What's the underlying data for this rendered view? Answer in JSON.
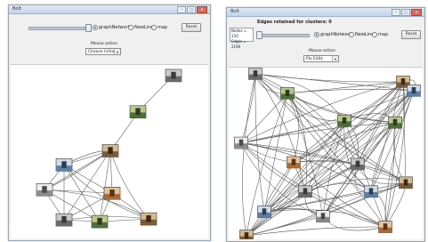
{
  "left_window": {
    "title": "Bolt",
    "radio_options": [
      "graphNetwork",
      "NewLine",
      "map"
    ],
    "selected_radio": "graphNetwork",
    "reset_label": "Reset",
    "mouse_action_label": "Mouse action",
    "mouse_action_value": "Choose Initiator"
  },
  "right_window": {
    "title": "Bolt",
    "heading": "Edges retained for clusters: 0",
    "info_lines": [
      "Nodes = 150",
      "Edges = 2190"
    ],
    "radio_options": [
      "graphNetwork",
      "NewLine",
      "map"
    ],
    "selected_radio": "graphNetwork",
    "reset_label": "Reset",
    "mouse_action_label": "Mouse action",
    "mouse_action_value": "Pix Edits"
  },
  "window_controls": {
    "minimize": "–",
    "maximize": "□",
    "close": "✕"
  },
  "colors": {
    "edge": "#555555",
    "window_border": "#9aa6b3",
    "titlebar": "#c4d5ea"
  },
  "icons": [
    "window-minimize-icon",
    "window-maximize-icon",
    "window-close-icon",
    "dropdown-arrow-icon"
  ]
}
